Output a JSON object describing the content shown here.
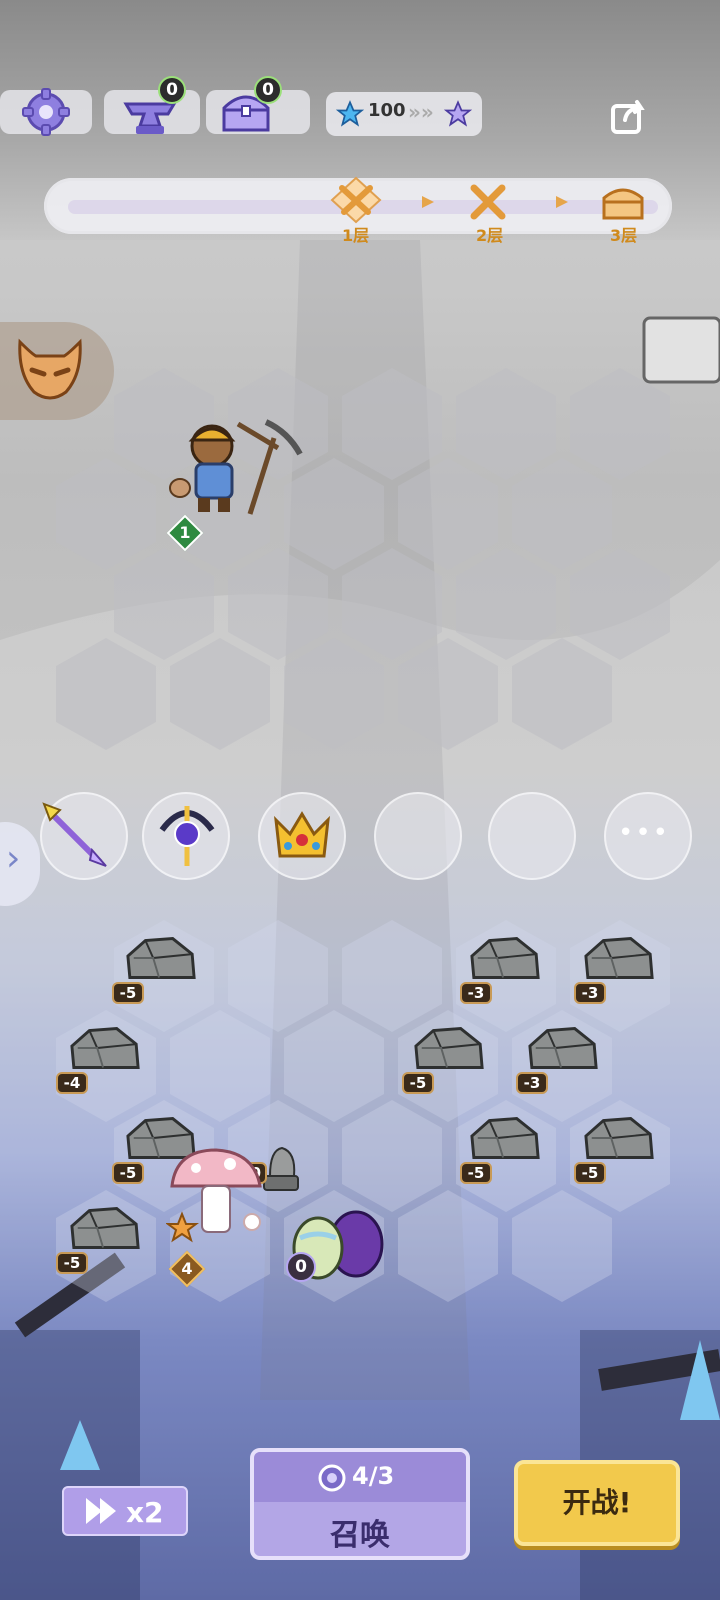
{
  "top_bar": {
    "settings_icon": "gear-icon",
    "anvil_count": "0",
    "chest_count": "0",
    "stars": "100",
    "share_icon": "share-icon"
  },
  "progress": {
    "stages": [
      {
        "label": "1层",
        "icon": "crossed-swords-icon"
      },
      {
        "label": "2层",
        "icon": "crossed-swords-icon"
      },
      {
        "label": "3层",
        "icon": "treasure-chest-icon"
      }
    ]
  },
  "units": {
    "miner_level": "1",
    "mushroom_level": "4",
    "egg_count": "0"
  },
  "rocks": [
    "-5",
    "-3",
    "-3",
    "-4",
    "-5",
    "-3",
    "-5",
    "-10",
    "-5",
    "-5",
    "-5"
  ],
  "summon": {
    "count": "4/3",
    "label": "召唤"
  },
  "fight_label": "开战!",
  "speed_label": "x2",
  "more_dots": "•••",
  "side_arrow": "›"
}
